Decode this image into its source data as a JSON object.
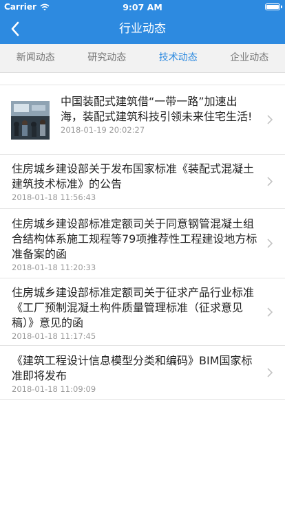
{
  "status_bar": {
    "carrier": "Carrier",
    "time": "9:07 AM"
  },
  "header": {
    "title": "行业动态"
  },
  "tabs": [
    {
      "label": "新闻动态",
      "active": false
    },
    {
      "label": "研究动态",
      "active": false
    },
    {
      "label": "技术动态",
      "active": true
    },
    {
      "label": "企业动态",
      "active": false
    }
  ],
  "articles": [
    {
      "title": "中国装配式建筑借“一带一路”加速出海，装配式建筑科技引领未来住宅生活!",
      "time": "2018-01-19 20:02:27",
      "has_thumbnail": true
    },
    {
      "title": "住房城乡建设部关于发布国家标准《装配式混凝土建筑技术标准》的公告",
      "time": "2018-01-18 11:56:43",
      "has_thumbnail": false
    },
    {
      "title": "住房城乡建设部标准定额司关于同意钢管混凝土组合结构体系施工规程等79项推荐性工程建设地方标准备案的函",
      "time": "2018-01-18 11:20:33",
      "has_thumbnail": false
    },
    {
      "title": "住房城乡建设部标准定额司关于征求产品行业标准《工厂预制混凝土构件质量管理标准（征求意见稿）》意见的函",
      "time": "2018-01-18 11:17:45",
      "has_thumbnail": false
    },
    {
      "title": "《建筑工程设计信息模型分类和编码》BIM国家标准即将发布",
      "time": "2018-01-18 11:09:09",
      "has_thumbnail": false
    }
  ],
  "colors": {
    "accent": "#2d8ae0",
    "tab_bg": "#f2f2f2",
    "text": "#222222",
    "muted": "#9a9a9a"
  }
}
